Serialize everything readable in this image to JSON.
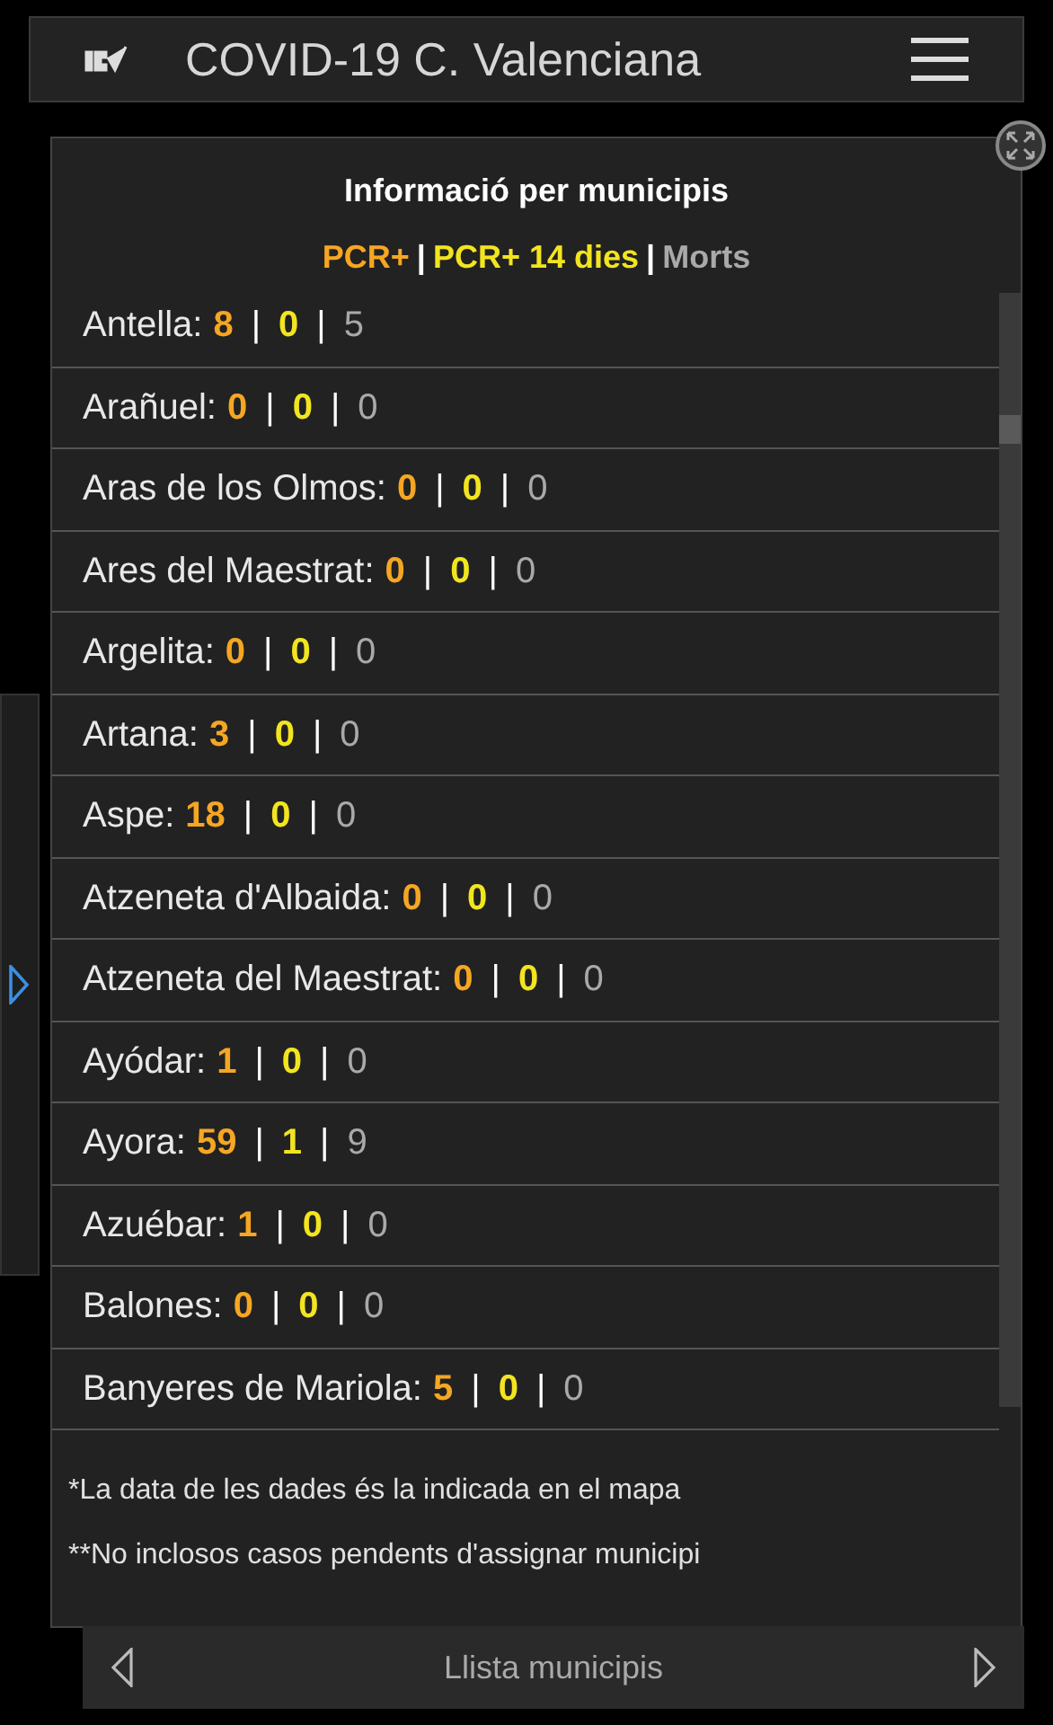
{
  "header": {
    "title": "COVID-19 C. Valenciana"
  },
  "panel": {
    "title": "Informació per municipis",
    "legend": [
      {
        "label": "PCR+",
        "kind": "pcr"
      },
      {
        "label": "PCR+ 14 dies",
        "kind": "pcr14"
      },
      {
        "label": "Morts",
        "kind": "morts"
      }
    ],
    "separator": "|",
    "rows": [
      {
        "name": "Antella:",
        "pcr": "8",
        "pcr14": "0",
        "morts": "5"
      },
      {
        "name": "Arañuel:",
        "pcr": "0",
        "pcr14": "0",
        "morts": "0"
      },
      {
        "name": "Aras de los Olmos:",
        "pcr": "0",
        "pcr14": "0",
        "morts": "0"
      },
      {
        "name": "Ares del Maestrat:",
        "pcr": "0",
        "pcr14": "0",
        "morts": "0"
      },
      {
        "name": "Argelita:",
        "pcr": "0",
        "pcr14": "0",
        "morts": "0"
      },
      {
        "name": "Artana:",
        "pcr": "3",
        "pcr14": "0",
        "morts": "0"
      },
      {
        "name": "Aspe:",
        "pcr": "18",
        "pcr14": "0",
        "morts": "0"
      },
      {
        "name": "Atzeneta d'Albaida:",
        "pcr": "0",
        "pcr14": "0",
        "morts": "0"
      },
      {
        "name": "Atzeneta del Maestrat:",
        "pcr": "0",
        "pcr14": "0",
        "morts": "0"
      },
      {
        "name": "Ayódar:",
        "pcr": "1",
        "pcr14": "0",
        "morts": "0"
      },
      {
        "name": "Ayora:",
        "pcr": "59",
        "pcr14": "1",
        "morts": "9"
      },
      {
        "name": "Azuébar:",
        "pcr": "1",
        "pcr14": "0",
        "morts": "0"
      },
      {
        "name": "Balones:",
        "pcr": "0",
        "pcr14": "0",
        "morts": "0"
      },
      {
        "name": "Banyeres de Mariola:",
        "pcr": "5",
        "pcr14": "0",
        "morts": "0"
      }
    ],
    "notes": [
      "*La data de les dades és la indicada en el mapa",
      "**No inclosos casos pendents d'assignar municipi"
    ]
  },
  "footer": {
    "label": "Llista municipis"
  }
}
